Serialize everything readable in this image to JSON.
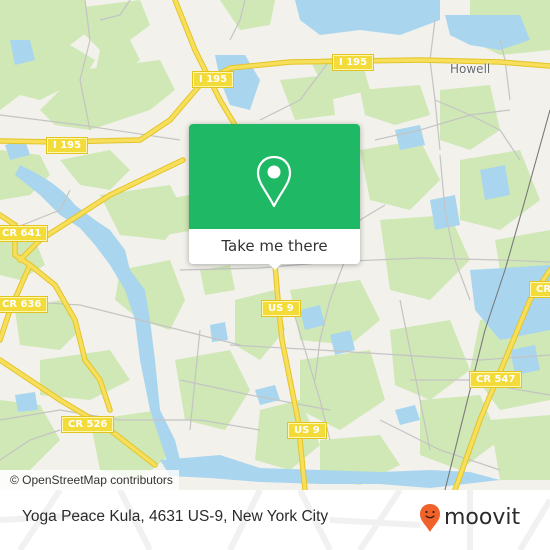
{
  "map": {
    "colors": {
      "background": "#f2f1ec",
      "woodland": "#cfe8b5",
      "water": "#a9d6ee",
      "highway": "#f5dc55",
      "minor_road": "#bdbdbd",
      "railway": "#6d6d6d"
    },
    "road_labels": [
      {
        "id": "i195-west",
        "text": "I 195"
      },
      {
        "id": "i195-center",
        "text": "I 195"
      },
      {
        "id": "i195-east",
        "text": "I 195"
      },
      {
        "id": "cr641",
        "text": "CR 641"
      },
      {
        "id": "cr636",
        "text": "CR 636"
      },
      {
        "id": "cr526",
        "text": "CR 526"
      },
      {
        "id": "us9-north",
        "text": "US 9"
      },
      {
        "id": "us9-south",
        "text": "US 9"
      },
      {
        "id": "cr547",
        "text": "CR 547"
      }
    ],
    "place_labels": [
      {
        "id": "howell",
        "text": "Howell"
      }
    ],
    "attribution": "© OpenStreetMap contributors"
  },
  "popup": {
    "icon": "location-pin-icon",
    "accent_color": "#1fb865",
    "button_label": "Take me there"
  },
  "footer": {
    "address": "Yoga Peace Kula, 4631 US-9, New York City",
    "logo": {
      "text": "moovit",
      "icon": "moovit-smiley-pin-icon",
      "color": "#f0622a"
    }
  }
}
